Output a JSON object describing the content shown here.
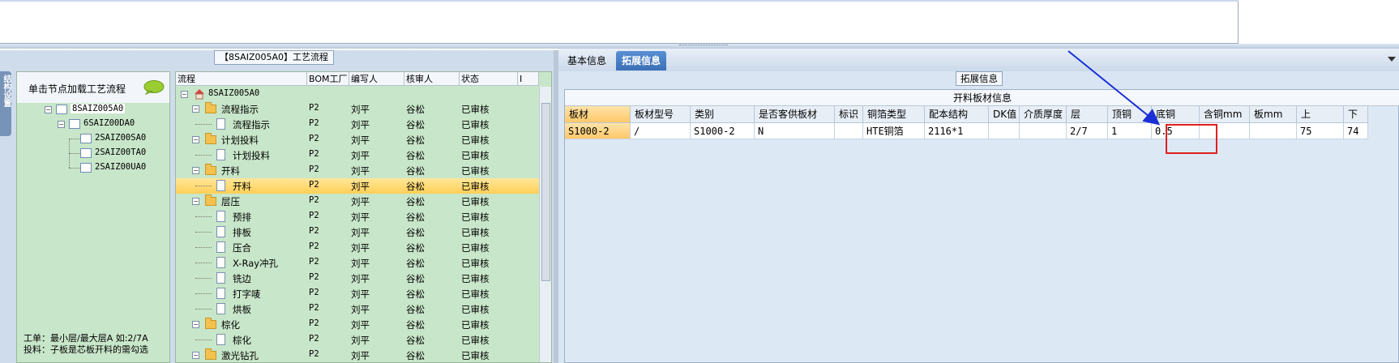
{
  "nav": {
    "header_label": "单击节点加载工艺流程",
    "tree": [
      "8SAIZ005A0",
      "6SAIZ00DA0",
      "2SAIZ00SA0",
      "2SAIZ00TA0",
      "2SAIZ00UA0"
    ],
    "note_line1": "工单：最小层/最大层A 如:2/7A",
    "note_line2": "投料：子板是芯板开料的需勾选",
    "vertical_tab": "结构设置"
  },
  "flow": {
    "title": "【8SAIZ005A0】工艺流程",
    "columns": [
      "流程",
      "BOM工厂",
      "编写人",
      "核审人",
      "状态",
      "I"
    ],
    "root": "8SAIZ005A0",
    "rows": [
      {
        "name": "流程指示",
        "type": "folder",
        "bom": "P2",
        "author": "刘平",
        "reviewer": "谷松",
        "status": "已审核"
      },
      {
        "name": "流程指示",
        "type": "doc",
        "bom": "P2",
        "author": "刘平",
        "reviewer": "谷松",
        "status": "已审核"
      },
      {
        "name": "计划投料",
        "type": "folder",
        "bom": "P2",
        "author": "刘平",
        "reviewer": "谷松",
        "status": "已审核"
      },
      {
        "name": "计划投料",
        "type": "doc",
        "bom": "P2",
        "author": "刘平",
        "reviewer": "谷松",
        "status": "已审核"
      },
      {
        "name": "开料",
        "type": "folder",
        "bom": "P2",
        "author": "刘平",
        "reviewer": "谷松",
        "status": "已审核"
      },
      {
        "name": "开料",
        "type": "doc",
        "bom": "P2",
        "author": "刘平",
        "reviewer": "谷松",
        "status": "已审核",
        "selected": true
      },
      {
        "name": "层压",
        "type": "folder",
        "bom": "P2",
        "author": "刘平",
        "reviewer": "谷松",
        "status": "已审核"
      },
      {
        "name": "预排",
        "type": "doc",
        "bom": "P2",
        "author": "刘平",
        "reviewer": "谷松",
        "status": "已审核"
      },
      {
        "name": "排板",
        "type": "doc",
        "bom": "P2",
        "author": "刘平",
        "reviewer": "谷松",
        "status": "已审核"
      },
      {
        "name": "压合",
        "type": "doc",
        "bom": "P2",
        "author": "刘平",
        "reviewer": "谷松",
        "status": "已审核"
      },
      {
        "name": "X-Ray冲孔",
        "type": "doc",
        "bom": "P2",
        "author": "刘平",
        "reviewer": "谷松",
        "status": "已审核"
      },
      {
        "name": "铣边",
        "type": "doc",
        "bom": "P2",
        "author": "刘平",
        "reviewer": "谷松",
        "status": "已审核"
      },
      {
        "name": "打字唛",
        "type": "doc",
        "bom": "P2",
        "author": "刘平",
        "reviewer": "谷松",
        "status": "已审核"
      },
      {
        "name": "烘板",
        "type": "doc",
        "bom": "P2",
        "author": "刘平",
        "reviewer": "谷松",
        "status": "已审核"
      },
      {
        "name": "棕化",
        "type": "folder",
        "bom": "P2",
        "author": "刘平",
        "reviewer": "谷松",
        "status": "已审核"
      },
      {
        "name": "棕化",
        "type": "doc",
        "bom": "P2",
        "author": "刘平",
        "reviewer": "谷松",
        "status": "已审核"
      },
      {
        "name": "激光钻孔",
        "type": "folder",
        "bom": "P2",
        "author": "刘平",
        "reviewer": "谷松",
        "status": "已审核"
      }
    ]
  },
  "right": {
    "tabs": [
      "基本信息",
      "拓展信息"
    ],
    "active_tab": 1,
    "group_label": "拓展信息",
    "grid_caption": "开料板材信息",
    "columns": [
      "板材",
      "板材型号",
      "类别",
      "是否客供板材",
      "标识",
      "铜箔类型",
      "配本结构",
      "DK值",
      "介质厚度",
      "层",
      "顶铜",
      "底铜",
      "含铜mm",
      "板mm",
      "上",
      "下"
    ],
    "row": [
      "S1000-2",
      "/",
      "S1000-2",
      "N",
      "",
      "HTE铜箔",
      "2116*1",
      "",
      "",
      "2/7",
      "1",
      "0.5",
      "",
      "",
      "75",
      "74"
    ],
    "highlight_color": "#e02020",
    "arrow_color": "#1a2fd6"
  }
}
